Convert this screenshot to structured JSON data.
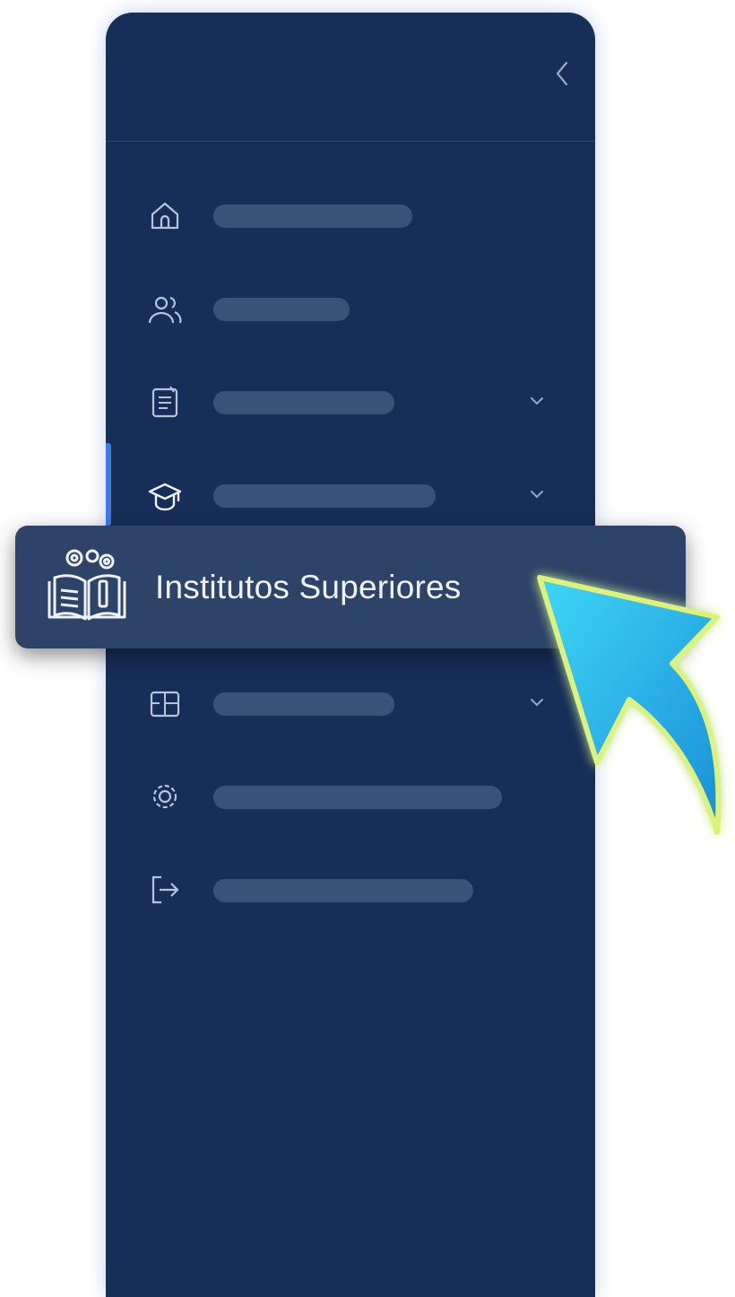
{
  "sidebar": {
    "collapse_icon": "chevron-left-icon",
    "items": [
      {
        "icon": "home-icon",
        "expandable": false
      },
      {
        "icon": "users-icon",
        "expandable": false
      },
      {
        "icon": "document-icon",
        "expandable": true
      },
      {
        "icon": "graduation-cap-icon",
        "expandable": true,
        "active": true
      },
      {
        "icon": "layout-icon",
        "expandable": true
      },
      {
        "icon": "gear-icon",
        "expandable": false
      },
      {
        "icon": "logout-icon",
        "expandable": false
      }
    ]
  },
  "flyout": {
    "label": "Institutos Superiores",
    "icon": "book-gears-icon"
  },
  "pointer": {
    "icon": "curved-arrow-pointer-icon"
  },
  "colors": {
    "sidebar_bg": "#172e58",
    "flyout_bg": "#2d4367",
    "placeholder": "#3a5178",
    "icon_stroke": "#c4cfe2",
    "active_indicator": "#3e7be8",
    "arrow_fill": "#27c3ee",
    "arrow_outline": "#d9f27a"
  }
}
